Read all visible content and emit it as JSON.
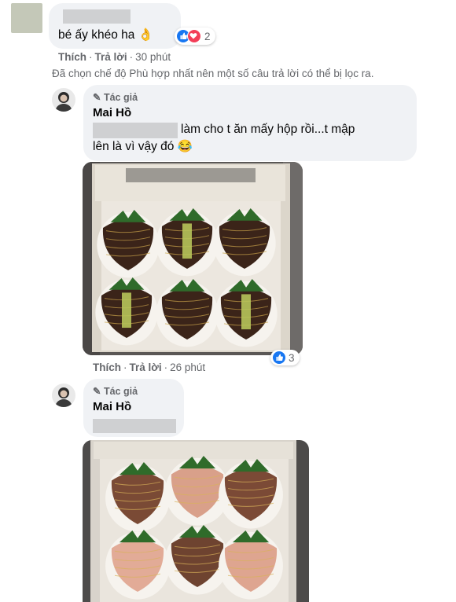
{
  "comment1": {
    "text": "bé ấy khéo ha",
    "emoji": "👌",
    "reaction_count": "2",
    "like_label": "Thích",
    "reply_label": "Trả lời",
    "time": "30 phút"
  },
  "filter_notice": "Đã chọn chế độ Phù hợp nhất nên một số câu trả lời có thể bị lọc ra.",
  "reply1": {
    "author_badge": "Tác giả",
    "author_name": "Mai Hồ",
    "text_line1": "làm cho t ăn mấy hộp rồi...t mập",
    "text_line2": "lên là vì vậy đó",
    "emoji": "😂",
    "reaction_count": "3",
    "like_label": "Thích",
    "reply_label": "Trả lời",
    "time": "26 phút"
  },
  "reply2": {
    "author_badge": "Tác giả",
    "author_name": "Mai Hồ"
  },
  "colors": {
    "bubble": "#f0f2f5",
    "like_blue": "#1877f2",
    "love_red": "#f33e58",
    "meta_gray": "#65676b"
  }
}
